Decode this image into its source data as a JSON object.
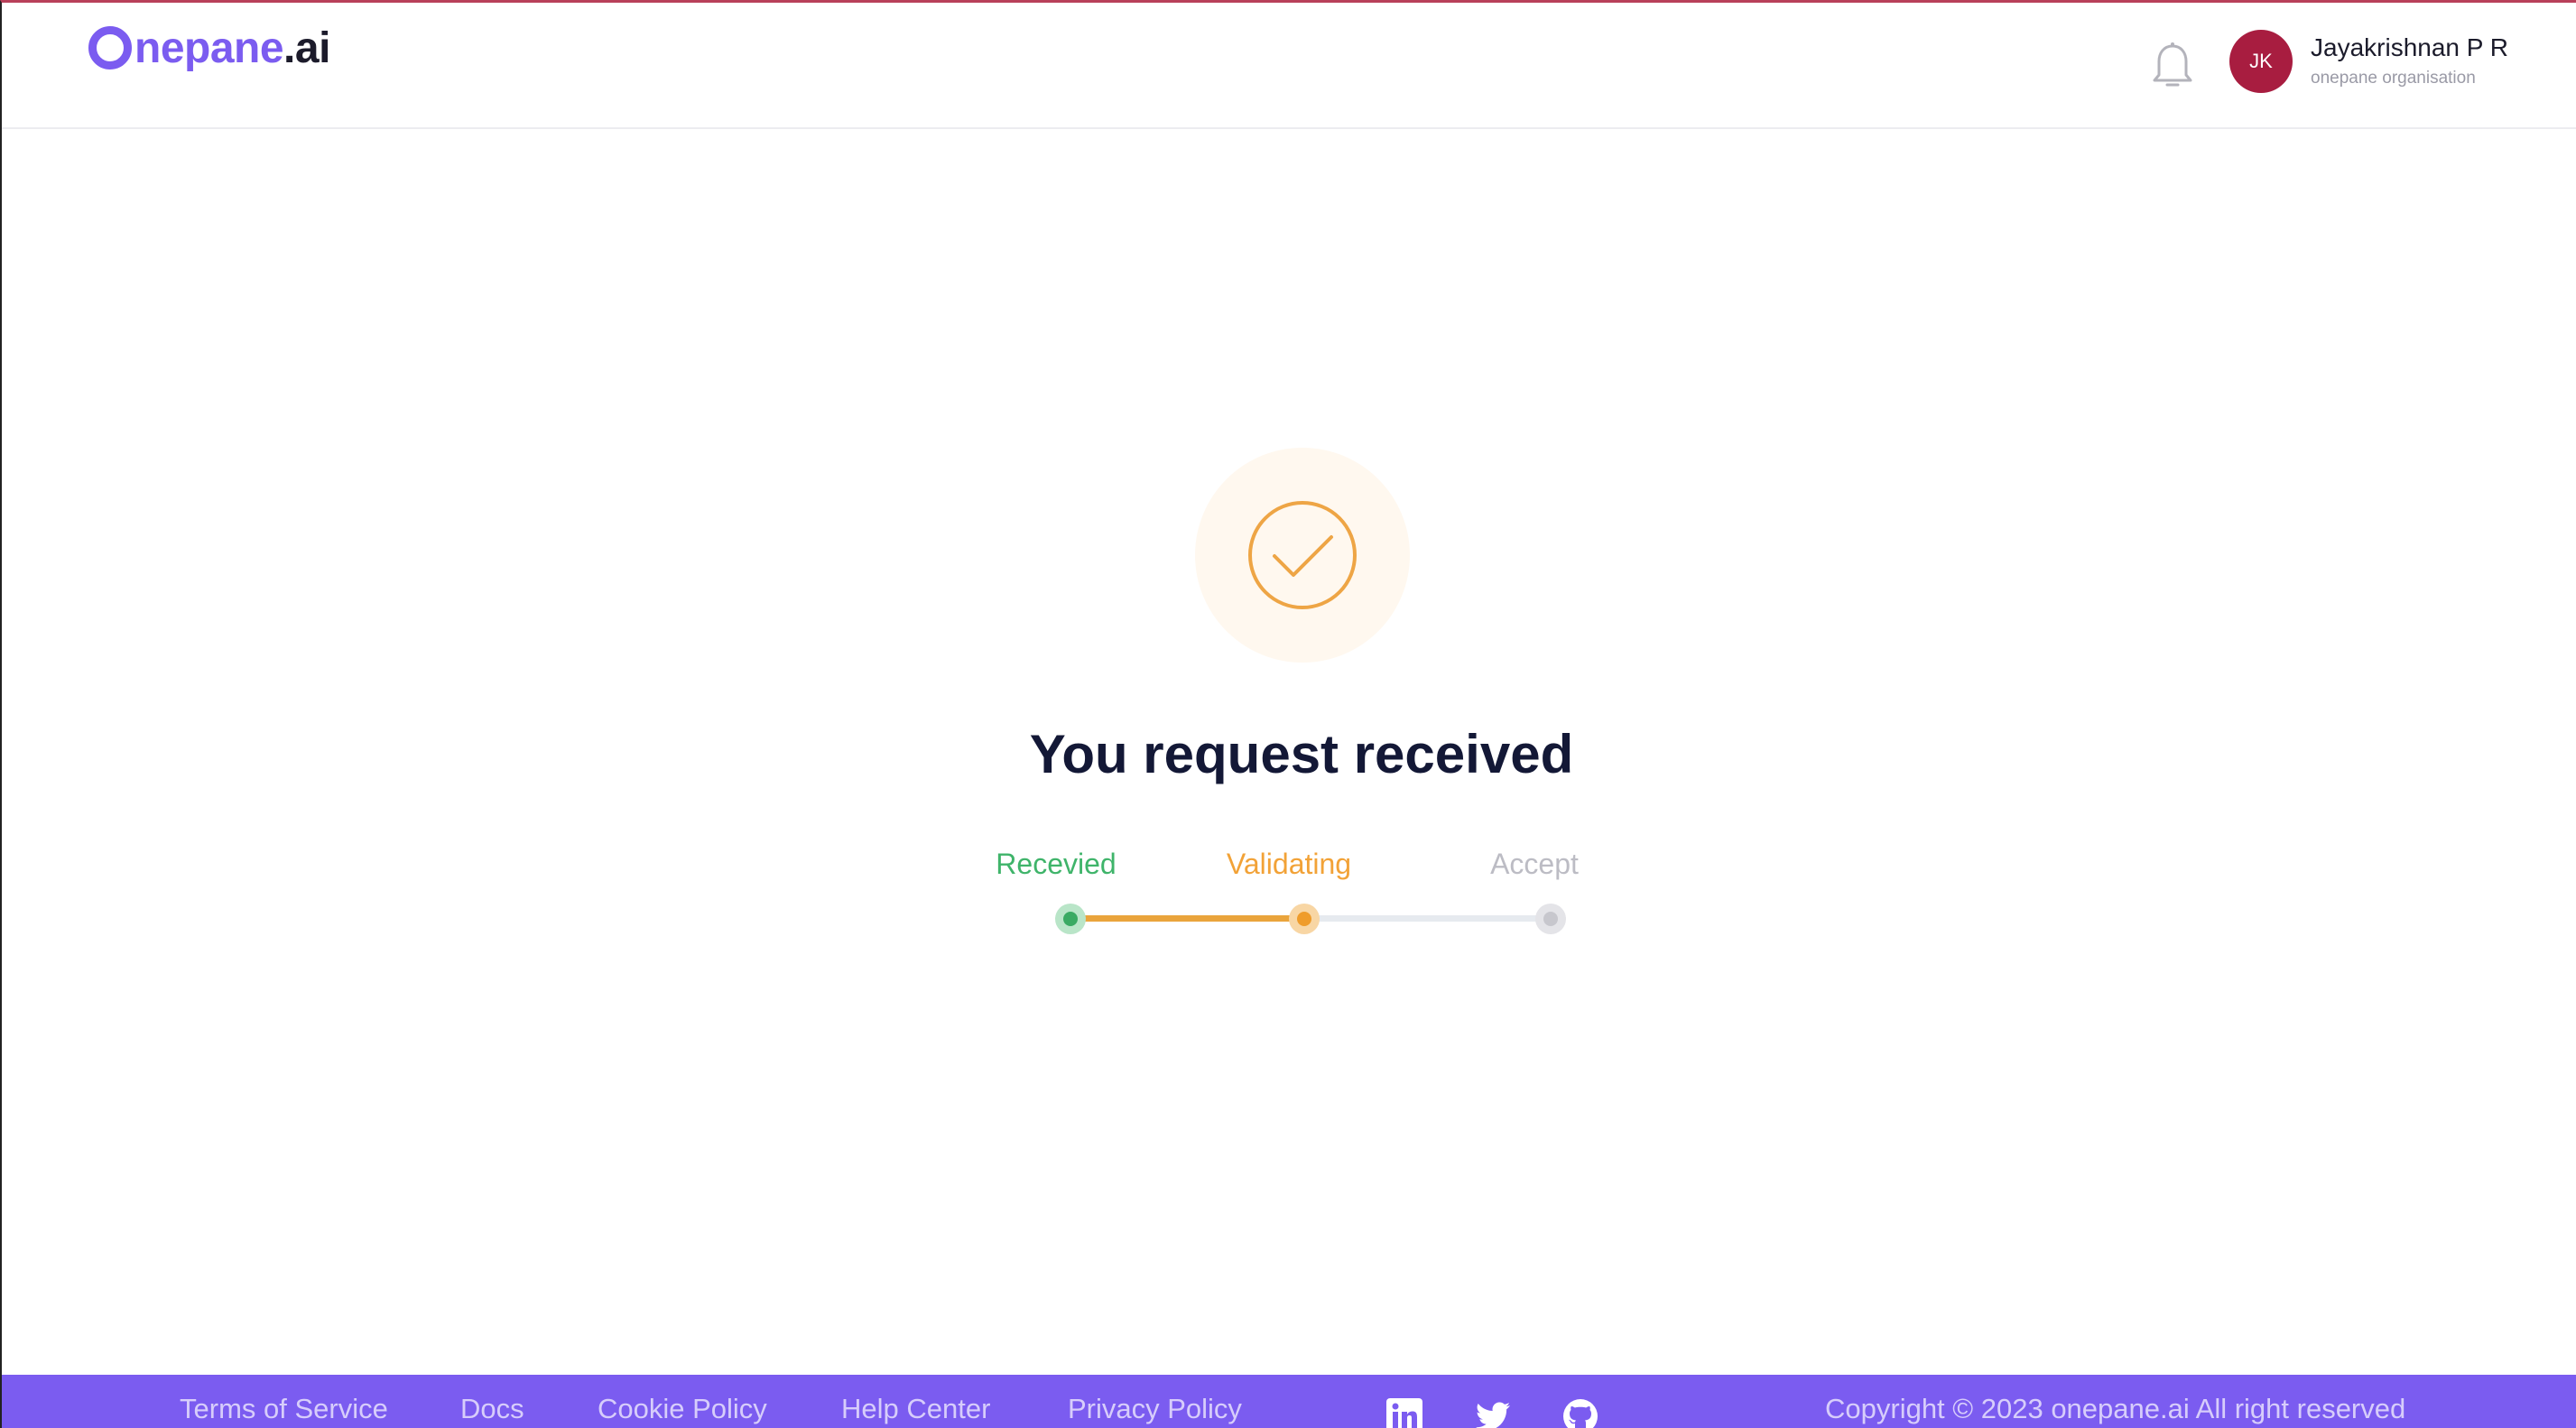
{
  "header": {
    "logo_brand": "nepane",
    "logo_tld": ".ai",
    "notification_icon": "bell-icon",
    "user": {
      "initials": "JK",
      "name": "Jayakrishnan P R",
      "organisation": "onepane organisation",
      "avatar_color": "#a81d40"
    }
  },
  "main": {
    "status_icon": "check-circle-icon",
    "headline": "You request received",
    "steps": [
      {
        "label": "Recevied",
        "state": "done",
        "color": "#3fb46a"
      },
      {
        "label": "Validating",
        "state": "current",
        "color": "#f2a237"
      },
      {
        "label": "Accept",
        "state": "pending",
        "color": "#bcbcc4"
      }
    ]
  },
  "footer": {
    "background": "#7b5cf0",
    "links": [
      "Terms of Service",
      "Docs",
      "Cookie Policy",
      "Help Center",
      "Privacy Policy"
    ],
    "social_icons": [
      "linkedin-icon",
      "twitter-icon",
      "github-icon"
    ],
    "copyright": "Copyright © 2023 onepane.ai All right reserved"
  },
  "colors": {
    "brand": "#7b5cf0",
    "success": "#3fb46a",
    "warning": "#f2a237",
    "muted": "#bcbcc4"
  }
}
